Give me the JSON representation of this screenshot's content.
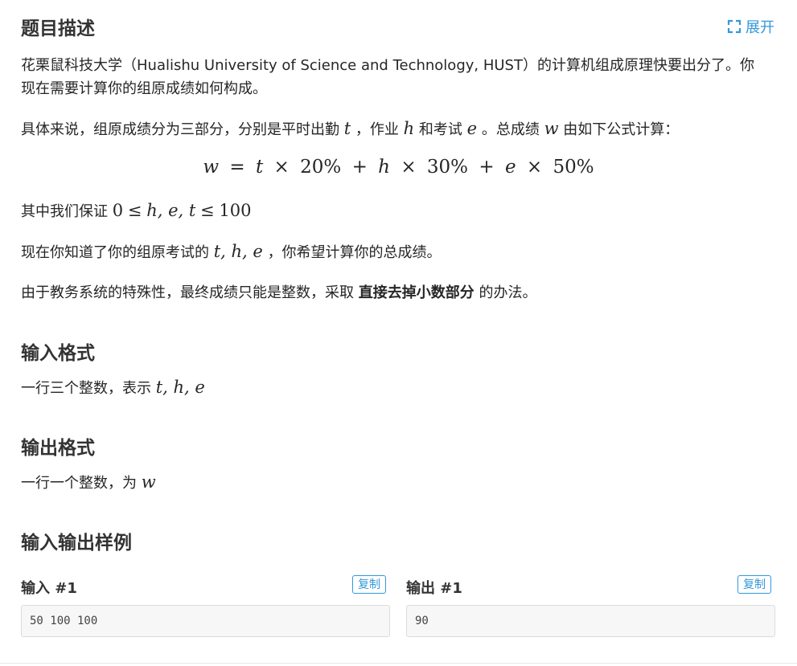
{
  "description": {
    "title": "题目描述",
    "expand_label": "展开",
    "p1": "花栗鼠科技大学（Hualishu University of Science and Technology, HUST）的计算机组成原理快要出分了。你现在需要计算你的组原成绩如何构成。",
    "p2_a": "具体来说，组原成绩分为三部分，分别是平时出勤",
    "p2_t": "t",
    "p2_b": "，作业",
    "p2_h": "h",
    "p2_c": "和考试",
    "p2_e": "e",
    "p2_d": "。总成绩",
    "p2_w": "w",
    "p2_f": "由如下公式计算：",
    "formula": {
      "w": "w",
      "eq": "=",
      "t": "t",
      "times": "×",
      "p20": "20%",
      "plus": "+",
      "h": "h",
      "p30": "30%",
      "e": "e",
      "p50": "50%"
    },
    "p3_a": "其中我们保证",
    "p3_zero": "0",
    "p3_le": "≤",
    "p3_vars": "h, e, t",
    "p3_hundred": "100",
    "p4_a": "现在你知道了你的组原考试的",
    "p4_vars": "t, h, e",
    "p4_b": "，你希望计算你的总成绩。",
    "p5_a": "由于教务系统的特殊性，最终成绩只能是整数，采取",
    "p5_bold": "直接去掉小数部分",
    "p5_b": "的办法。"
  },
  "input_format": {
    "title": "输入格式",
    "text": "一行三个整数，表示",
    "vars": "t, h, e"
  },
  "output_format": {
    "title": "输出格式",
    "text": "一行一个整数，为",
    "var": "w"
  },
  "samples": {
    "title": "输入输出样例",
    "input_label": "输入 #1",
    "output_label": "输出 #1",
    "copy_label": "复制",
    "input_value": "50 100 100",
    "output_value": "90"
  },
  "colors": {
    "accent": "#3498db",
    "text": "#262626",
    "code_bg": "#f7f7f7"
  }
}
